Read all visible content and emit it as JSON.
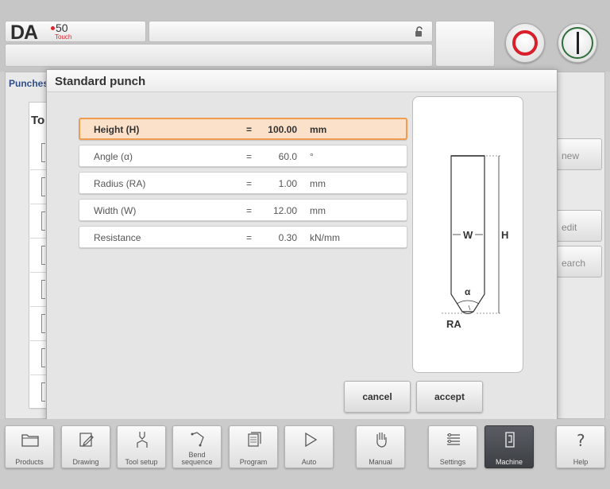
{
  "header": {
    "brand": "DA",
    "brand_model": "50",
    "brand_sub": "Touch"
  },
  "background": {
    "tab_label": "Punches",
    "table_header": "To",
    "buttons": [
      {
        "label": "new"
      },
      {
        "label": "edit"
      },
      {
        "label": "earch"
      }
    ]
  },
  "dialog": {
    "title": "Standard punch",
    "params": [
      {
        "label": "Height (H)",
        "eq": "=",
        "value": "100.00",
        "unit": "mm",
        "selected": true
      },
      {
        "label": "Angle (α)",
        "eq": "=",
        "value": "60.0",
        "unit": "°",
        "selected": false
      },
      {
        "label": "Radius (RA)",
        "eq": "=",
        "value": "1.00",
        "unit": "mm",
        "selected": false
      },
      {
        "label": "Width (W)",
        "eq": "=",
        "value": "12.00",
        "unit": "mm",
        "selected": false
      },
      {
        "label": "Resistance",
        "eq": "=",
        "value": "0.30",
        "unit": "kN/mm",
        "selected": false
      }
    ],
    "diagram": {
      "width_label": "W",
      "height_label": "H",
      "angle_label": "α",
      "radius_label": "RA"
    },
    "cancel_label": "cancel",
    "accept_label": "accept",
    "selected_color": "#fbe1c9",
    "selected_border": "#ee9c4f"
  },
  "nav": {
    "items": [
      {
        "label": "Products",
        "icon": "folder-icon"
      },
      {
        "label": "Drawing",
        "icon": "pencil-icon"
      },
      {
        "label": "Tool setup",
        "icon": "tool-setup-icon"
      },
      {
        "label": "Bend sequence",
        "icon": "bend-sequence-icon"
      },
      {
        "label": "Program",
        "icon": "program-pages-icon"
      },
      {
        "label": "Auto",
        "icon": "play-icon"
      },
      {
        "label": "Manual",
        "icon": "hand-icon"
      },
      {
        "label": "Settings",
        "icon": "settings-list-icon"
      },
      {
        "label": "Machine",
        "icon": "machine-icon"
      },
      {
        "label": "Help",
        "icon": "question-icon"
      }
    ],
    "active": "Machine"
  },
  "colors": {
    "stop": "#d81f2a",
    "start": "#2f6e3a",
    "accent_text": "#2f4d8a"
  }
}
